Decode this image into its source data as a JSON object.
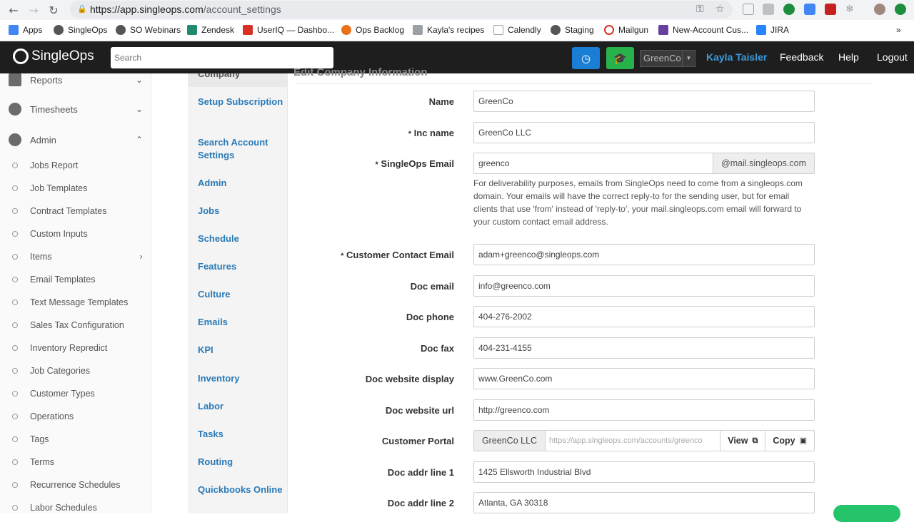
{
  "browser": {
    "url_host": "https://app.singleops.com",
    "url_path": "/account_settings",
    "bookmarks": [
      {
        "label": "Apps",
        "color": "#4285f4"
      },
      {
        "label": "SingleOps",
        "color": "#555555"
      },
      {
        "label": "SO Webinars",
        "color": "#555555"
      },
      {
        "label": "Zendesk",
        "color": "#1f8a70"
      },
      {
        "label": "UserIQ — Dashbo...",
        "color": "#d93025"
      },
      {
        "label": "Ops Backlog",
        "color": "#e8711a"
      },
      {
        "label": "Kayla's recipes",
        "color": "#9aa0a6"
      },
      {
        "label": "Calendly",
        "color": "#9aa0a6"
      },
      {
        "label": "Staging",
        "color": "#555555"
      },
      {
        "label": "Mailgun",
        "color": "#d93025"
      },
      {
        "label": "New-Account Cus...",
        "color": "#6a3ea1"
      },
      {
        "label": "JIRA",
        "color": "#2684ff"
      }
    ],
    "more_bookmarks": "»"
  },
  "header": {
    "logo": "SingleOps",
    "search_placeholder": "Search",
    "company_select": "GreenCo",
    "user_name": "Kayla Taisler",
    "feedback": "Feedback",
    "help": "Help",
    "logout": "Logout",
    "colors": {
      "clock_button": "#1a7fd4",
      "training_button": "#27b24a",
      "user_link": "#3a9bdc"
    }
  },
  "sidebar": {
    "sections": [
      {
        "label": "Reports",
        "chevron": "⌄"
      },
      {
        "label": "Timesheets",
        "chevron": "⌄"
      },
      {
        "label": "Admin",
        "chevron": "⌃"
      }
    ],
    "items": [
      {
        "label": "Jobs Report"
      },
      {
        "label": "Job Templates"
      },
      {
        "label": "Contract Templates"
      },
      {
        "label": "Custom Inputs"
      },
      {
        "label": "Items",
        "chevron": "›"
      },
      {
        "label": "Email Templates"
      },
      {
        "label": "Text Message Templates"
      },
      {
        "label": "Sales Tax Configuration"
      },
      {
        "label": "Inventory Repredict"
      },
      {
        "label": "Job Categories"
      },
      {
        "label": "Customer Types"
      },
      {
        "label": "Operations"
      },
      {
        "label": "Tags"
      },
      {
        "label": "Terms"
      },
      {
        "label": "Recurrence Schedules"
      },
      {
        "label": "Labor Schedules"
      }
    ]
  },
  "settings_nav": {
    "active": "Company",
    "items": [
      "Setup Subscription",
      "Search Account Settings",
      "Admin",
      "Jobs",
      "Schedule",
      "Features",
      "Culture",
      "Emails",
      "KPI",
      "Inventory",
      "Labor",
      "Tasks",
      "Routing",
      "Quickbooks Online"
    ]
  },
  "form": {
    "title": "Edit Company Information",
    "name": {
      "label": "Name",
      "value": "GreenCo"
    },
    "inc_name": {
      "label": "Inc name",
      "value": "GreenCo LLC",
      "required": "*"
    },
    "singleops_email": {
      "label": "SingleOps Email",
      "value": "greenco",
      "suffix": "@mail.singleops.com",
      "required": "*"
    },
    "help_text": "For deliverability purposes, emails from SingleOps need to come from a singleops.com domain. Your emails will have the correct reply-to for the sending user, but for email clients that use 'from' instead of 'reply-to', your mail.singleops.com email will forward to your custom contact email address.",
    "customer_contact_email": {
      "label": "Customer Contact Email",
      "value": "adam+greenco@singleops.com",
      "required": "*"
    },
    "doc_email": {
      "label": "Doc email",
      "value": "info@greenco.com"
    },
    "doc_phone": {
      "label": "Doc phone",
      "value": "404-276-2002"
    },
    "doc_fax": {
      "label": "Doc fax",
      "value": "404-231-4155"
    },
    "doc_website_display": {
      "label": "Doc website display",
      "value": "www.GreenCo.com"
    },
    "doc_website_url": {
      "label": "Doc website url",
      "value": "http://greenco.com"
    },
    "customer_portal": {
      "label": "Customer Portal",
      "name": "GreenCo LLC",
      "url": "https://app.singleops.com/accounts/greenco",
      "view": "View",
      "copy": "Copy"
    },
    "doc_addr_line_1": {
      "label": "Doc addr line 1",
      "value": "1425 Ellsworth Industrial Blvd"
    },
    "doc_addr_line_2": {
      "label": "Doc addr line 2",
      "value": "Atlanta, GA 30318"
    }
  }
}
